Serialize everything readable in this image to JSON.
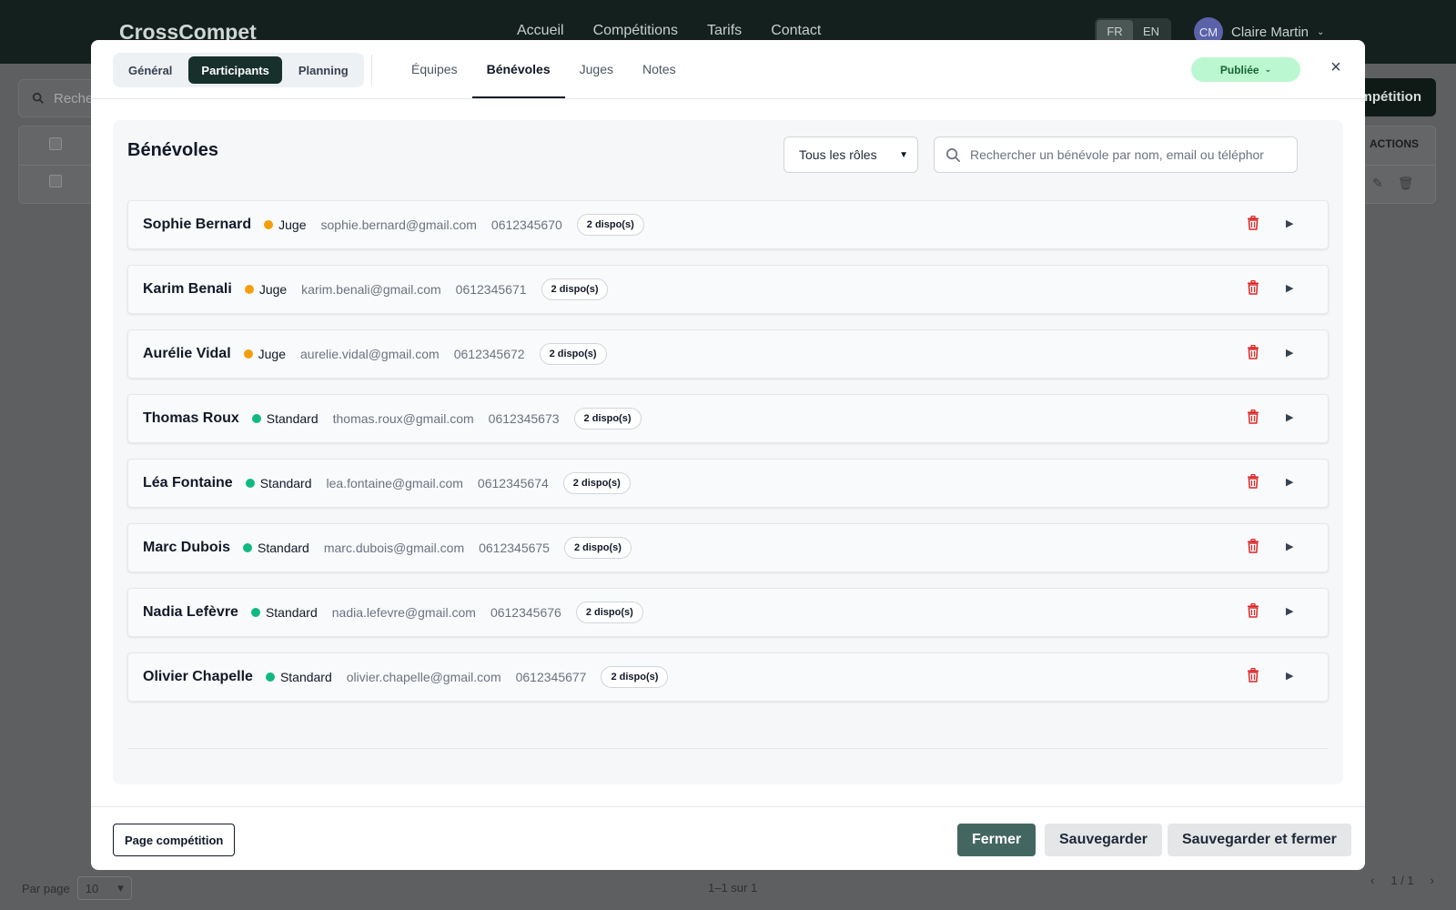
{
  "app": {
    "brand": "CrossCompet",
    "nav": [
      "Accueil",
      "Compétitions",
      "Tarifs",
      "Contact"
    ],
    "languages": [
      "FR",
      "EN"
    ],
    "active_language": "FR",
    "user": {
      "initials": "CM",
      "name": "Claire Martin"
    }
  },
  "background": {
    "search_placeholder": "Recher",
    "new_button": "mpétition",
    "actions_header": "ACTIONS",
    "per_page_label": "Par page",
    "per_page_value": "10",
    "range_text": "1–1 sur 1",
    "page_text": "1 / 1"
  },
  "modal": {
    "segments": [
      {
        "label": "Général",
        "active": false
      },
      {
        "label": "Participants",
        "active": true
      },
      {
        "label": "Planning",
        "active": false
      }
    ],
    "tabs": [
      {
        "label": "Équipes",
        "active": false
      },
      {
        "label": "Bénévoles",
        "active": true
      },
      {
        "label": "Juges",
        "active": false
      },
      {
        "label": "Notes",
        "active": false
      }
    ],
    "status": "Publiée",
    "close_symbol": "×",
    "panel_title": "Bénévoles",
    "role_filter": {
      "selected": "Tous les rôles"
    },
    "search_placeholder": "Rechercher un bénévole par nom, email ou téléphor",
    "role_colors": {
      "Juge": "#f59e0b",
      "Standard": "#10b981"
    },
    "delete_color": "#dc2626",
    "volunteers": [
      {
        "name": "Sophie Bernard",
        "role": "Juge",
        "email": "sophie.bernard@gmail.com",
        "phone": "0612345670",
        "dispo": "2 dispo(s)"
      },
      {
        "name": "Karim Benali",
        "role": "Juge",
        "email": "karim.benali@gmail.com",
        "phone": "0612345671",
        "dispo": "2 dispo(s)"
      },
      {
        "name": "Aurélie Vidal",
        "role": "Juge",
        "email": "aurelie.vidal@gmail.com",
        "phone": "0612345672",
        "dispo": "2 dispo(s)"
      },
      {
        "name": "Thomas Roux",
        "role": "Standard",
        "email": "thomas.roux@gmail.com",
        "phone": "0612345673",
        "dispo": "2 dispo(s)"
      },
      {
        "name": "Léa Fontaine",
        "role": "Standard",
        "email": "lea.fontaine@gmail.com",
        "phone": "0612345674",
        "dispo": "2 dispo(s)"
      },
      {
        "name": "Marc Dubois",
        "role": "Standard",
        "email": "marc.dubois@gmail.com",
        "phone": "0612345675",
        "dispo": "2 dispo(s)"
      },
      {
        "name": "Nadia Lefèvre",
        "role": "Standard",
        "email": "nadia.lefevre@gmail.com",
        "phone": "0612345676",
        "dispo": "2 dispo(s)"
      },
      {
        "name": "Olivier Chapelle",
        "role": "Standard",
        "email": "olivier.chapelle@gmail.com",
        "phone": "0612345677",
        "dispo": "2 dispo(s)"
      }
    ],
    "footer": {
      "page_button": "Page compétition",
      "close_button": "Fermer",
      "save_button": "Sauvegarder",
      "save_close_button": "Sauvegarder et fermer"
    }
  }
}
